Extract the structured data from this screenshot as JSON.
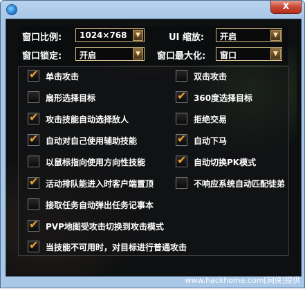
{
  "window": {
    "close_label": "X"
  },
  "settings": {
    "resolution_label": "窗口比例:",
    "resolution_value": "1024×768",
    "ui_scale_label": "UI 缩放:",
    "ui_scale_value": "开启",
    "lock_label": "窗口锁定:",
    "lock_value": "开启",
    "maximize_label": "窗口最大化:",
    "maximize_value": "窗口"
  },
  "options": [
    {
      "label": "单击攻击",
      "checked": true
    },
    {
      "label": "双击攻击",
      "checked": false
    },
    {
      "label": "扇形选择目标",
      "checked": false
    },
    {
      "label": "360度选择目标",
      "checked": true
    },
    {
      "label": "攻击技能自动选择敌人",
      "checked": true
    },
    {
      "label": "拒绝交易",
      "checked": false
    },
    {
      "label": "自动对自己使用辅助技能",
      "checked": true
    },
    {
      "label": "自动下马",
      "checked": true
    },
    {
      "label": "以鼠标指向使用方向性技能",
      "checked": false
    },
    {
      "label": "自动切换PK模式",
      "checked": true
    },
    {
      "label": "活动排队能进入时客户端置顶",
      "checked": true
    },
    {
      "label": "不响应系统自动匹配徒弟",
      "checked": false
    },
    {
      "label": "接取任务自动弹出任务记事本",
      "checked": false
    },
    {
      "label": "PVP地图受攻击切换到攻击模式",
      "checked": true
    },
    {
      "label": "当技能不可用时，对目标进行普通攻击",
      "checked": true
    }
  ],
  "tick_symbol": "✔",
  "dropdown_symbol": "▼",
  "watermark": "www.hackhome.com[网侠]提供",
  "colors": {
    "tick": "#f2a230",
    "combo_border": "#d8c08a",
    "title_bar": "#b9d3ee"
  }
}
